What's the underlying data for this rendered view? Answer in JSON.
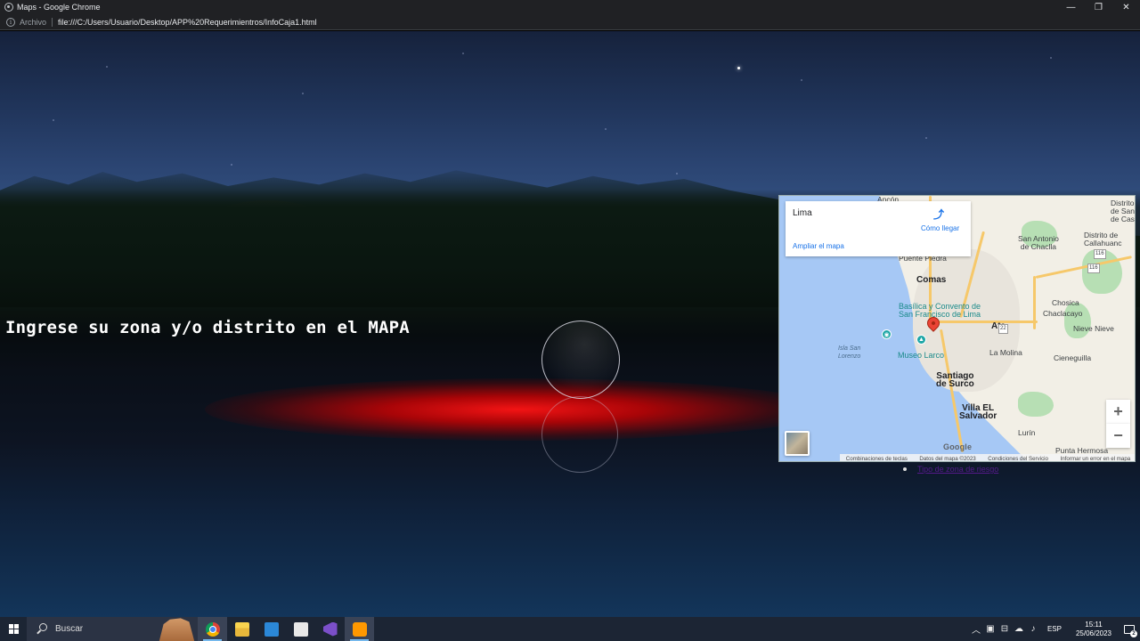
{
  "window": {
    "title": "Maps - Google Chrome",
    "minimize_glyph": "—",
    "restore_glyph": "❐",
    "close_glyph": "✕"
  },
  "addressbar": {
    "security_label": "Archivo",
    "url": "file:///C:/Users/Usuario/Desktop/APP%20Requerimientros/InfoCaja1.html"
  },
  "page": {
    "prompt_text": "Ingrese su zona y/o distrito en el MAPA",
    "below_map_link": "Tipo de zona de riesgo"
  },
  "map": {
    "place_name": "Lima",
    "directions_label": "Cómo llegar",
    "expand_link": "Ampliar el mapa",
    "zoom_in_label": "+",
    "zoom_out_label": "−",
    "google_logo": "Google",
    "attribution": {
      "shortcuts": "Combinaciones de teclas",
      "map_data": "Datos del mapa ©2023",
      "terms": "Condiciones del Servicio",
      "report": "Informar un error en el mapa"
    },
    "labels": {
      "ancon": "Ancón",
      "distrito_san_cas": "Distrito\nde San\nde Cas",
      "puente_piedra": "Puente Piedra",
      "san_antonio": "San Antonio\nde Chaclla",
      "distrito_callahuanca": "Distrito de\nCallahuanc",
      "comas": "Comas",
      "basilica": "Basílica y Convento de\nSan Francisco de Lima",
      "chosica": "Chosica",
      "chaclacayo": "Chaclacayo",
      "ate": "Ate",
      "nieve_nieve": "Nieve Nieve",
      "isla_san_lorenzo": "Isla San\nLorenzo",
      "museo_larco": "Museo Larco",
      "la_molina": "La Molina",
      "cieneguilla": "Cieneguilla",
      "santiago_de_surco": "Santiago\nde Surco",
      "villa_el_salvador": "Villa EL\nSalvador",
      "lurin": "Lurín",
      "punta_hermosa": "Punta Hermosa",
      "r22": "22",
      "r116a": "116",
      "r116b": "116"
    }
  },
  "taskbar": {
    "search_placeholder": "Buscar",
    "language": "ESP",
    "time": "15:11",
    "date": "25/06/2023",
    "notification_count": "2",
    "tray_chevron": "︿"
  },
  "colors": {
    "accent_link": "#1a73e8",
    "pin": "#ea4335",
    "glow": "#ff1414",
    "taskbar": "#1c2534"
  }
}
